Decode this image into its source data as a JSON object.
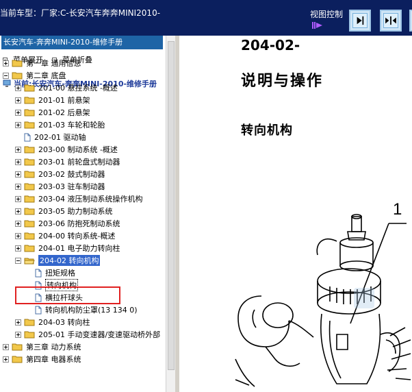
{
  "header": {
    "car_title": "当前车型：厂家:C-长安汽车奔奔MINI2010-",
    "view_control_label": "视图控制",
    "buttons": [
      {
        "name": "next-page-button",
        "icon": "arrow-to-line-right-icon"
      },
      {
        "name": "split-view-button",
        "icon": "arrows-inward-icon"
      }
    ]
  },
  "sidebar": {
    "manual_title": "长安汽车-奔奔MINI-2010-维修手册",
    "expand_all": "菜单展开",
    "collapse_all": "菜单折叠",
    "current": "当前:长安汽车-奔奔MINI-2010-维修手册",
    "tree": [
      {
        "label": "第一章 通用信息",
        "type": "folder",
        "expander": "plus",
        "level": 0
      },
      {
        "label": "第二章 底盘",
        "type": "folder",
        "expander": "minus",
        "level": 0
      },
      {
        "label": "201-00 悬挂系统 -概述",
        "type": "folder",
        "expander": "plus",
        "level": 1
      },
      {
        "label": "201-01 前悬架",
        "type": "folder",
        "expander": "plus",
        "level": 1
      },
      {
        "label": "201-02 后悬架",
        "type": "folder",
        "expander": "plus",
        "level": 1
      },
      {
        "label": "201-03 车轮和轮胎",
        "type": "folder",
        "expander": "plus",
        "level": 1
      },
      {
        "label": "202-01 驱动轴",
        "type": "doc",
        "expander": "none",
        "level": 1
      },
      {
        "label": "203-00 制动系统 -概述",
        "type": "folder",
        "expander": "plus",
        "level": 1
      },
      {
        "label": "203-01 前轮盘式制动器",
        "type": "folder",
        "expander": "plus",
        "level": 1
      },
      {
        "label": "203-02 鼓式制动器",
        "type": "folder",
        "expander": "plus",
        "level": 1
      },
      {
        "label": "203-03 驻车制动器",
        "type": "folder",
        "expander": "plus",
        "level": 1
      },
      {
        "label": "203-04 液压制动系统操作机构",
        "type": "folder",
        "expander": "plus",
        "level": 1
      },
      {
        "label": "203-05 助力制动系统",
        "type": "folder",
        "expander": "plus",
        "level": 1
      },
      {
        "label": "203-06 防抱死制动系统",
        "type": "folder",
        "expander": "plus",
        "level": 1
      },
      {
        "label": "204-00 转向系统-概述",
        "type": "folder",
        "expander": "plus",
        "level": 1
      },
      {
        "label": "204-01 电子助力转向柱",
        "type": "folder",
        "expander": "plus",
        "level": 1
      },
      {
        "label": "204-02 转向机构",
        "type": "folder-open",
        "expander": "minus",
        "level": 1,
        "selected": true
      },
      {
        "label": "扭矩规格",
        "type": "doc",
        "expander": "none",
        "level": 2
      },
      {
        "label": "转向机构",
        "type": "doc",
        "expander": "none",
        "level": 2,
        "focused": true
      },
      {
        "label": "横拉杆球头",
        "type": "doc",
        "expander": "none",
        "level": 2
      },
      {
        "label": "转向机构防尘罩(13 134 0)",
        "type": "doc",
        "expander": "none",
        "level": 2
      },
      {
        "label": "204-03 转向柱",
        "type": "folder",
        "expander": "plus",
        "level": 1
      },
      {
        "label": "205-01 手动变速器/变速驱动桥外部",
        "type": "folder",
        "expander": "plus",
        "level": 1
      },
      {
        "label": "第三章 动力系统",
        "type": "folder",
        "expander": "plus",
        "level": 0
      },
      {
        "label": "第四章 电器系统",
        "type": "folder",
        "expander": "plus",
        "level": 0
      }
    ]
  },
  "document": {
    "code": "204-02-",
    "heading": "说明与操作",
    "subheading": "转向机构",
    "callout": "1"
  },
  "colors": {
    "header_bg": "#0b1f5e",
    "title_bg": "#1e64a6",
    "selection_bg": "#3366cc",
    "highlight_border": "#e02020",
    "folder": "#f2c84b"
  }
}
